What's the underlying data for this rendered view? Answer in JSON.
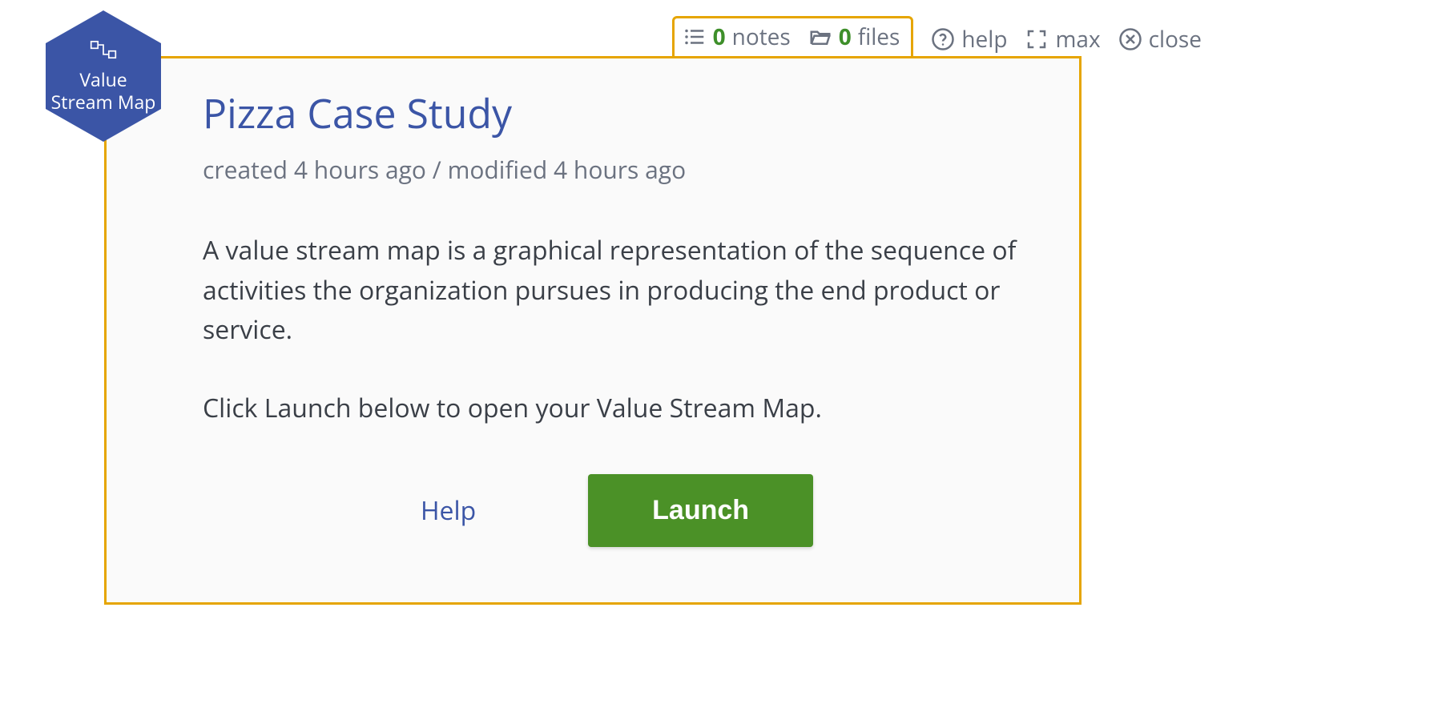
{
  "toolbar": {
    "notes": {
      "count": "0",
      "label": "notes"
    },
    "files": {
      "count": "0",
      "label": "files"
    },
    "help": {
      "label": "help"
    },
    "max": {
      "label": "max"
    },
    "close": {
      "label": "close"
    }
  },
  "badge": {
    "line1": "Value",
    "line2": "Stream Map"
  },
  "card": {
    "title": "Pizza Case Study",
    "meta": "created 4 hours ago / modified 4 hours ago",
    "para1": "A value stream map is a graphical representation of the sequence of activities the organization pursues in producing the end product or service.",
    "para2": "Click Launch below to open your Value Stream Map.",
    "help_link": "Help",
    "launch_button": "Launch"
  }
}
